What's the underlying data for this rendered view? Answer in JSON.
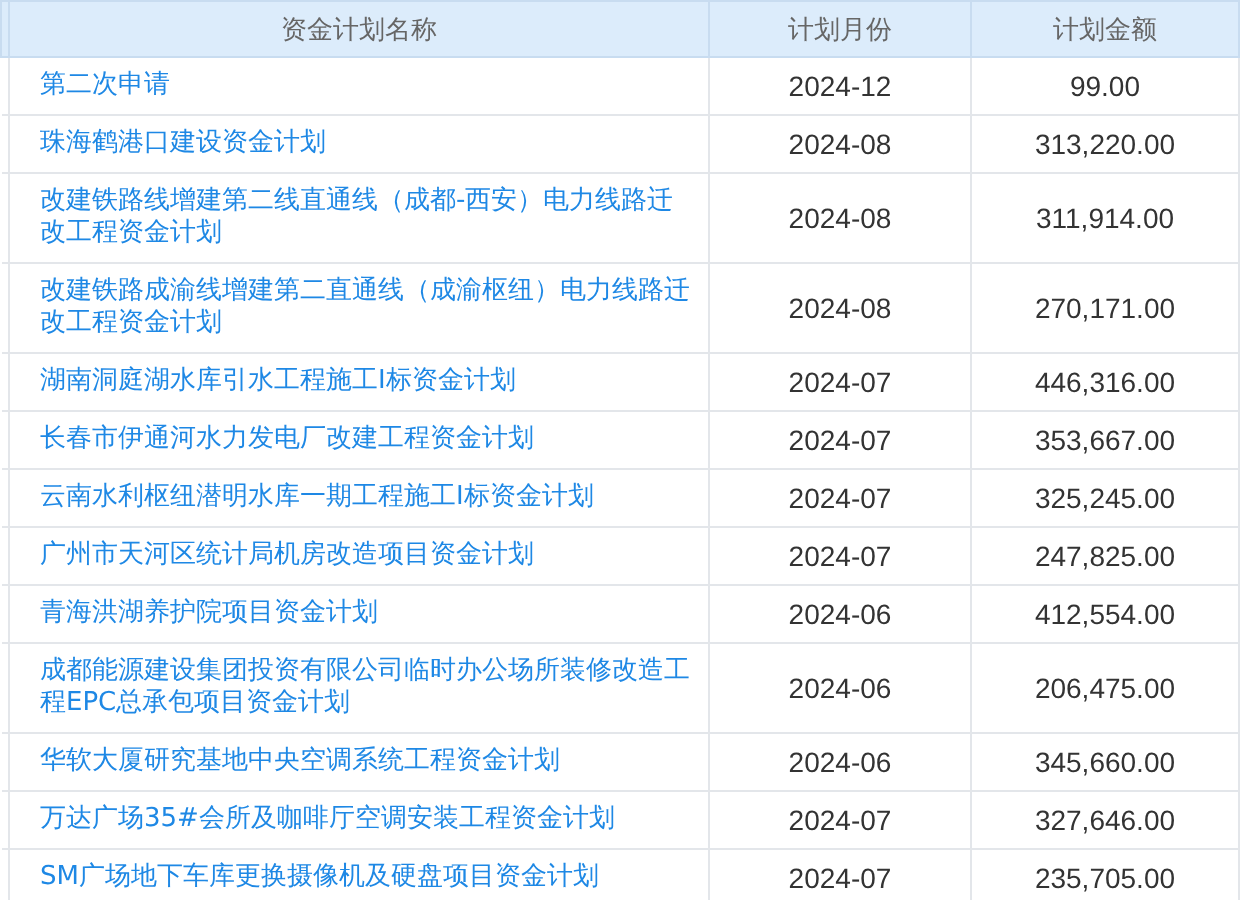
{
  "table": {
    "columns": [
      "资金计划名称",
      "计划月份",
      "计划金额"
    ],
    "rows": [
      {
        "name": "第二次申请",
        "month": "2024-12",
        "amount": "99.00"
      },
      {
        "name": "珠海鹤港口建设资金计划",
        "month": "2024-08",
        "amount": "313,220.00"
      },
      {
        "name": "改建铁路线增建第二线直通线（成都-西安）电力线路迁改工程资金计划",
        "month": "2024-08",
        "amount": "311,914.00"
      },
      {
        "name": "改建铁路成渝线增建第二直通线（成渝枢纽）电力线路迁改工程资金计划",
        "month": "2024-08",
        "amount": "270,171.00"
      },
      {
        "name": "湖南洞庭湖水库引水工程施工I标资金计划",
        "month": "2024-07",
        "amount": "446,316.00"
      },
      {
        "name": "长春市伊通河水力发电厂改建工程资金计划",
        "month": "2024-07",
        "amount": "353,667.00"
      },
      {
        "name": "云南水利枢纽潜明水库一期工程施工I标资金计划",
        "month": "2024-07",
        "amount": "325,245.00"
      },
      {
        "name": "广州市天河区统计局机房改造项目资金计划",
        "month": "2024-07",
        "amount": "247,825.00"
      },
      {
        "name": "青海洪湖养护院项目资金计划",
        "month": "2024-06",
        "amount": "412,554.00"
      },
      {
        "name": "成都能源建设集团投资有限公司临时办公场所装修改造工程EPC总承包项目资金计划",
        "month": "2024-06",
        "amount": "206,475.00"
      },
      {
        "name": "华软大厦研究基地中央空调系统工程资金计划",
        "month": "2024-06",
        "amount": "345,660.00"
      },
      {
        "name": "万达广场35#会所及咖啡厅空调安装工程资金计划",
        "month": "2024-07",
        "amount": "327,646.00"
      },
      {
        "name": "SM广场地下车库更换摄像机及硬盘项目资金计划",
        "month": "2024-07",
        "amount": "235,705.00"
      }
    ]
  }
}
